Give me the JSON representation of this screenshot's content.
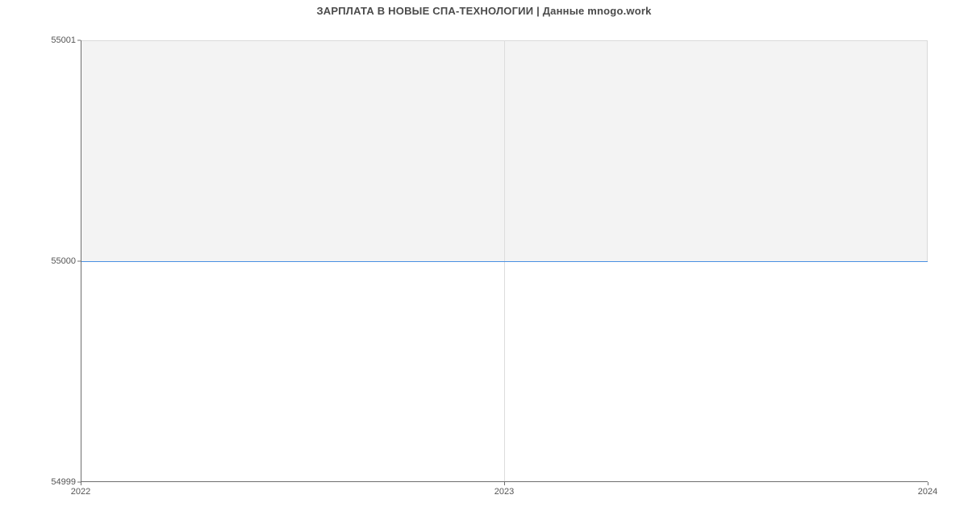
{
  "chart_data": {
    "type": "line",
    "title": "ЗАРПЛАТА В НОВЫЕ СПА-ТЕХНОЛОГИИ | Данные mnogo.work",
    "xlabel": "",
    "ylabel": "",
    "x": [
      2022,
      2023,
      2024
    ],
    "values": [
      55000,
      55000,
      55000
    ],
    "ylim": [
      54999,
      55001
    ],
    "xlim": [
      2022,
      2024
    ],
    "y_ticks": [
      54999,
      55000,
      55001
    ],
    "x_ticks": [
      2022,
      2023,
      2024
    ]
  }
}
